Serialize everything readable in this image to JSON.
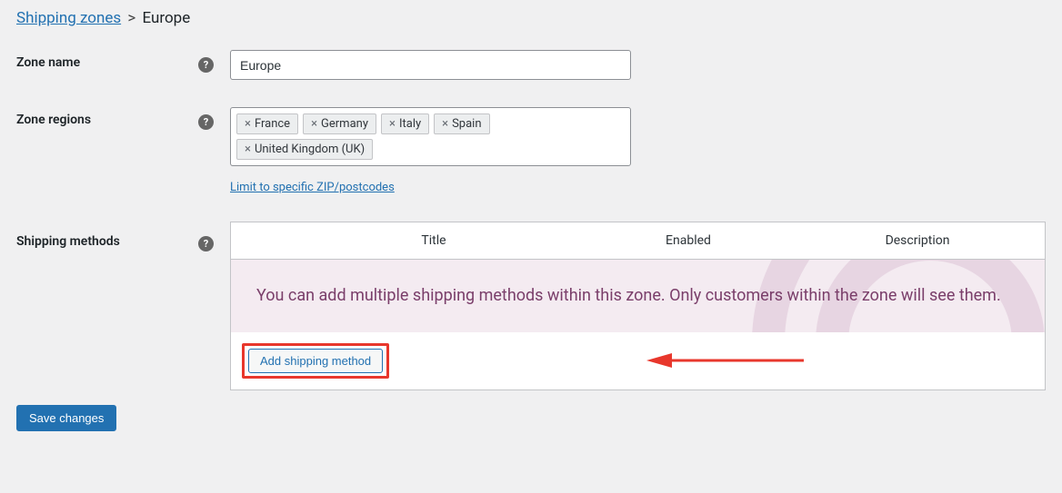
{
  "breadcrumb": {
    "parent": "Shipping zones",
    "current": "Europe"
  },
  "labels": {
    "zone_name": "Zone name",
    "zone_regions": "Zone regions",
    "shipping_methods": "Shipping methods"
  },
  "zone_name_value": "Europe",
  "regions": [
    "France",
    "Germany",
    "Italy",
    "Spain",
    "United Kingdom (UK)"
  ],
  "limit_link": "Limit to specific ZIP/postcodes",
  "table_headers": {
    "title": "Title",
    "enabled": "Enabled",
    "description": "Description"
  },
  "placeholder_text": "You can add multiple shipping methods within this zone. Only customers within the zone will see them.",
  "add_method_label": "Add shipping method",
  "save_label": "Save changes"
}
